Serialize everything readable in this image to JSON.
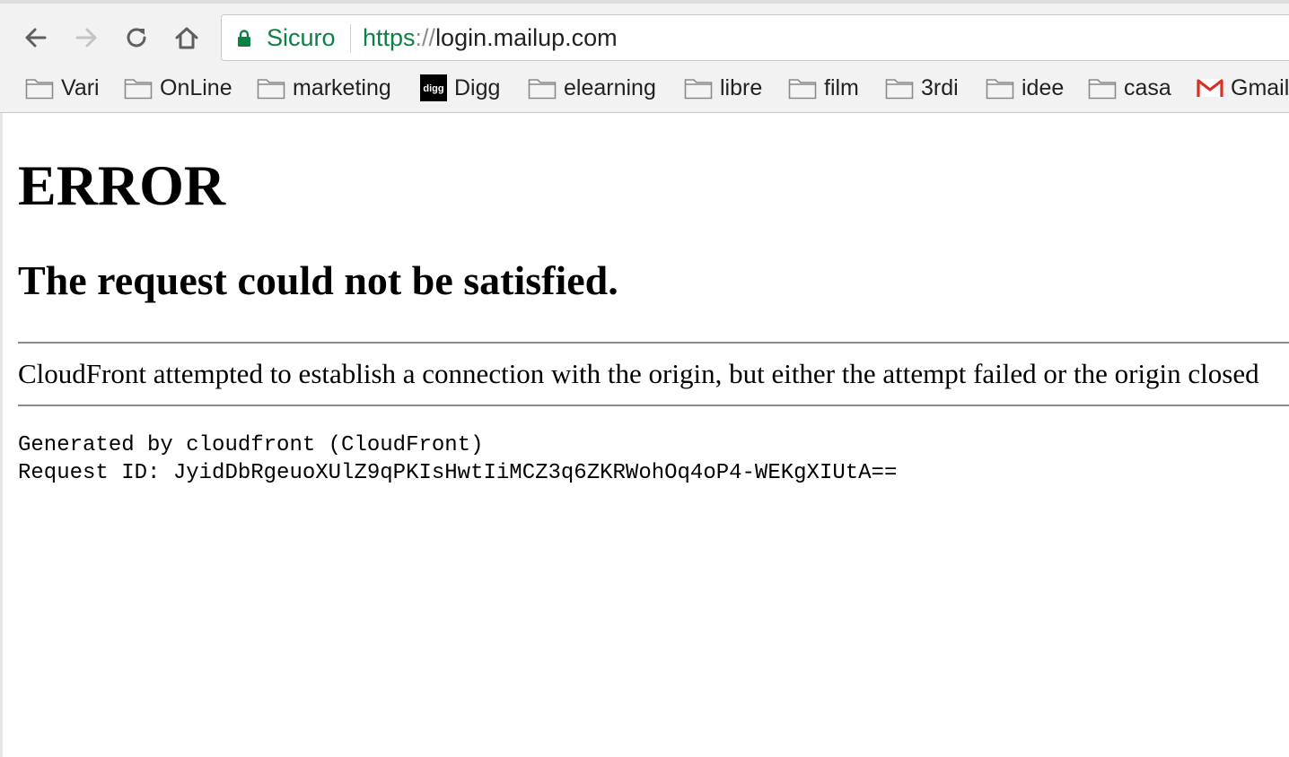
{
  "browser": {
    "security_label": "Sicuro",
    "url_scheme": "https",
    "url_separator": "://",
    "url_host": "login.mailup.com",
    "bookmarks": [
      {
        "label": "Vari",
        "icon": "folder-icon"
      },
      {
        "label": "OnLine",
        "icon": "folder-icon"
      },
      {
        "label": "marketing",
        "icon": "folder-icon"
      },
      {
        "label": "Digg",
        "icon": "digg-icon"
      },
      {
        "label": "elearning",
        "icon": "folder-icon"
      },
      {
        "label": "libre",
        "icon": "folder-icon"
      },
      {
        "label": "film",
        "icon": "folder-icon"
      },
      {
        "label": "3rdi",
        "icon": "folder-icon"
      },
      {
        "label": "idee",
        "icon": "folder-icon"
      },
      {
        "label": "casa",
        "icon": "folder-icon"
      },
      {
        "label": "Gmail",
        "icon": "gmail-icon"
      }
    ],
    "colors": {
      "secure": "#0b8043",
      "gmail_red": "#d93025"
    }
  },
  "page": {
    "title": "ERROR",
    "subtitle": "The request could not be satisfied.",
    "message": "CloudFront attempted to establish a connection with the origin, but either the attempt failed or the origin closed",
    "generated_by": "Generated by cloudfront (CloudFront)",
    "request_id": "Request ID: JyidDbRgeuoXUlZ9qPKIsHwtIiMCZ3q6ZKRWohOq4oP4-WEKgXIUtA=="
  }
}
